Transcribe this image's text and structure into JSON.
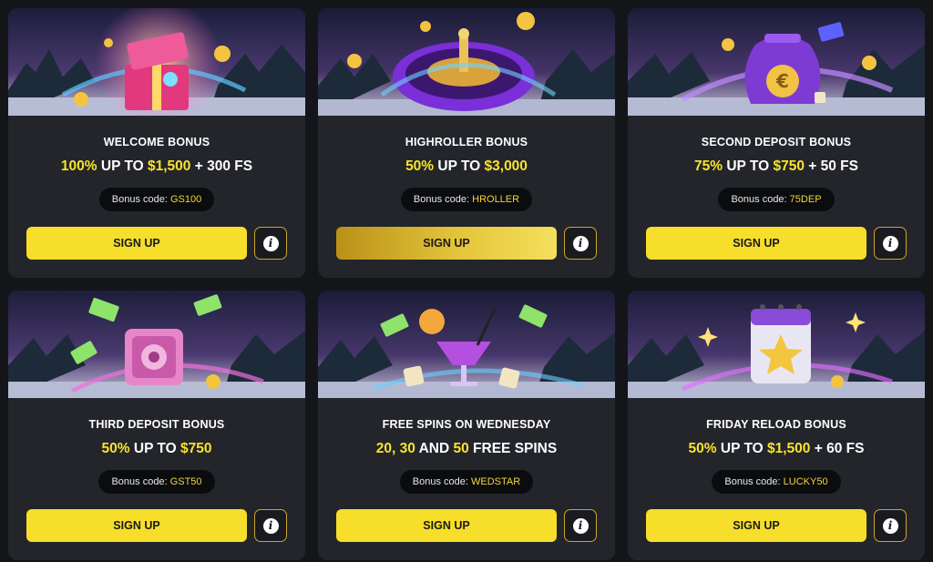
{
  "cards": [
    {
      "title": "WELCOME BONUS",
      "offer": [
        {
          "t": "100%",
          "y": true
        },
        {
          "t": " UP TO ",
          "y": false
        },
        {
          "t": "$1,500",
          "y": true
        },
        {
          "t": " + 300 FS",
          "y": false
        }
      ],
      "code_label": "Bonus code: ",
      "code": "GS100",
      "button": "SIGN UP",
      "info_icon": "info-icon",
      "art": "gift-box"
    },
    {
      "title": "HIGHROLLER BONUS",
      "offer": [
        {
          "t": "50%",
          "y": true
        },
        {
          "t": " UP TO ",
          "y": false
        },
        {
          "t": "$3,000",
          "y": true
        }
      ],
      "code_label": "Bonus code: ",
      "code": "HROLLER",
      "button": "SIGN UP",
      "info_icon": "info-icon",
      "art": "roulette-wheel"
    },
    {
      "title": "SECOND DEPOSIT BONUS",
      "offer": [
        {
          "t": "75%",
          "y": true
        },
        {
          "t": " UP TO ",
          "y": false
        },
        {
          "t": "$750",
          "y": true
        },
        {
          "t": " + 50 FS",
          "y": false
        }
      ],
      "code_label": "Bonus code: ",
      "code": "75DEP",
      "button": "SIGN UP",
      "info_icon": "info-icon",
      "art": "money-bag"
    },
    {
      "title": "THIRD DEPOSIT BONUS",
      "offer": [
        {
          "t": "50%",
          "y": true
        },
        {
          "t": " UP TO ",
          "y": false
        },
        {
          "t": "$750",
          "y": true
        }
      ],
      "code_label": "Bonus code: ",
      "code": "GST50",
      "button": "SIGN UP",
      "info_icon": "info-icon",
      "art": "safe"
    },
    {
      "title": "FREE SPINS ON WEDNESDAY",
      "offer": [
        {
          "t": "20, 30",
          "y": true
        },
        {
          "t": " AND ",
          "y": false
        },
        {
          "t": "50",
          "y": true
        },
        {
          "t": " FREE SPINS",
          "y": false
        }
      ],
      "code_label": "Bonus code: ",
      "code": "WEDSTAR",
      "button": "SIGN UP",
      "info_icon": "info-icon",
      "art": "cocktail-dice"
    },
    {
      "title": "FRIDAY RELOAD BONUS",
      "offer": [
        {
          "t": "50%",
          "y": true
        },
        {
          "t": " UP TO ",
          "y": false
        },
        {
          "t": "$1,500",
          "y": true
        },
        {
          "t": " + 60 FS",
          "y": false
        }
      ],
      "code_label": "Bonus code: ",
      "code": "LUCKY50",
      "button": "SIGN UP",
      "info_icon": "info-icon",
      "art": "calendar-star"
    }
  ],
  "colors": {
    "accent_yellow": "#f9e32d",
    "card_bg": "#23252b",
    "page_bg": "#141519",
    "pill_bg": "#0b0c0e"
  }
}
